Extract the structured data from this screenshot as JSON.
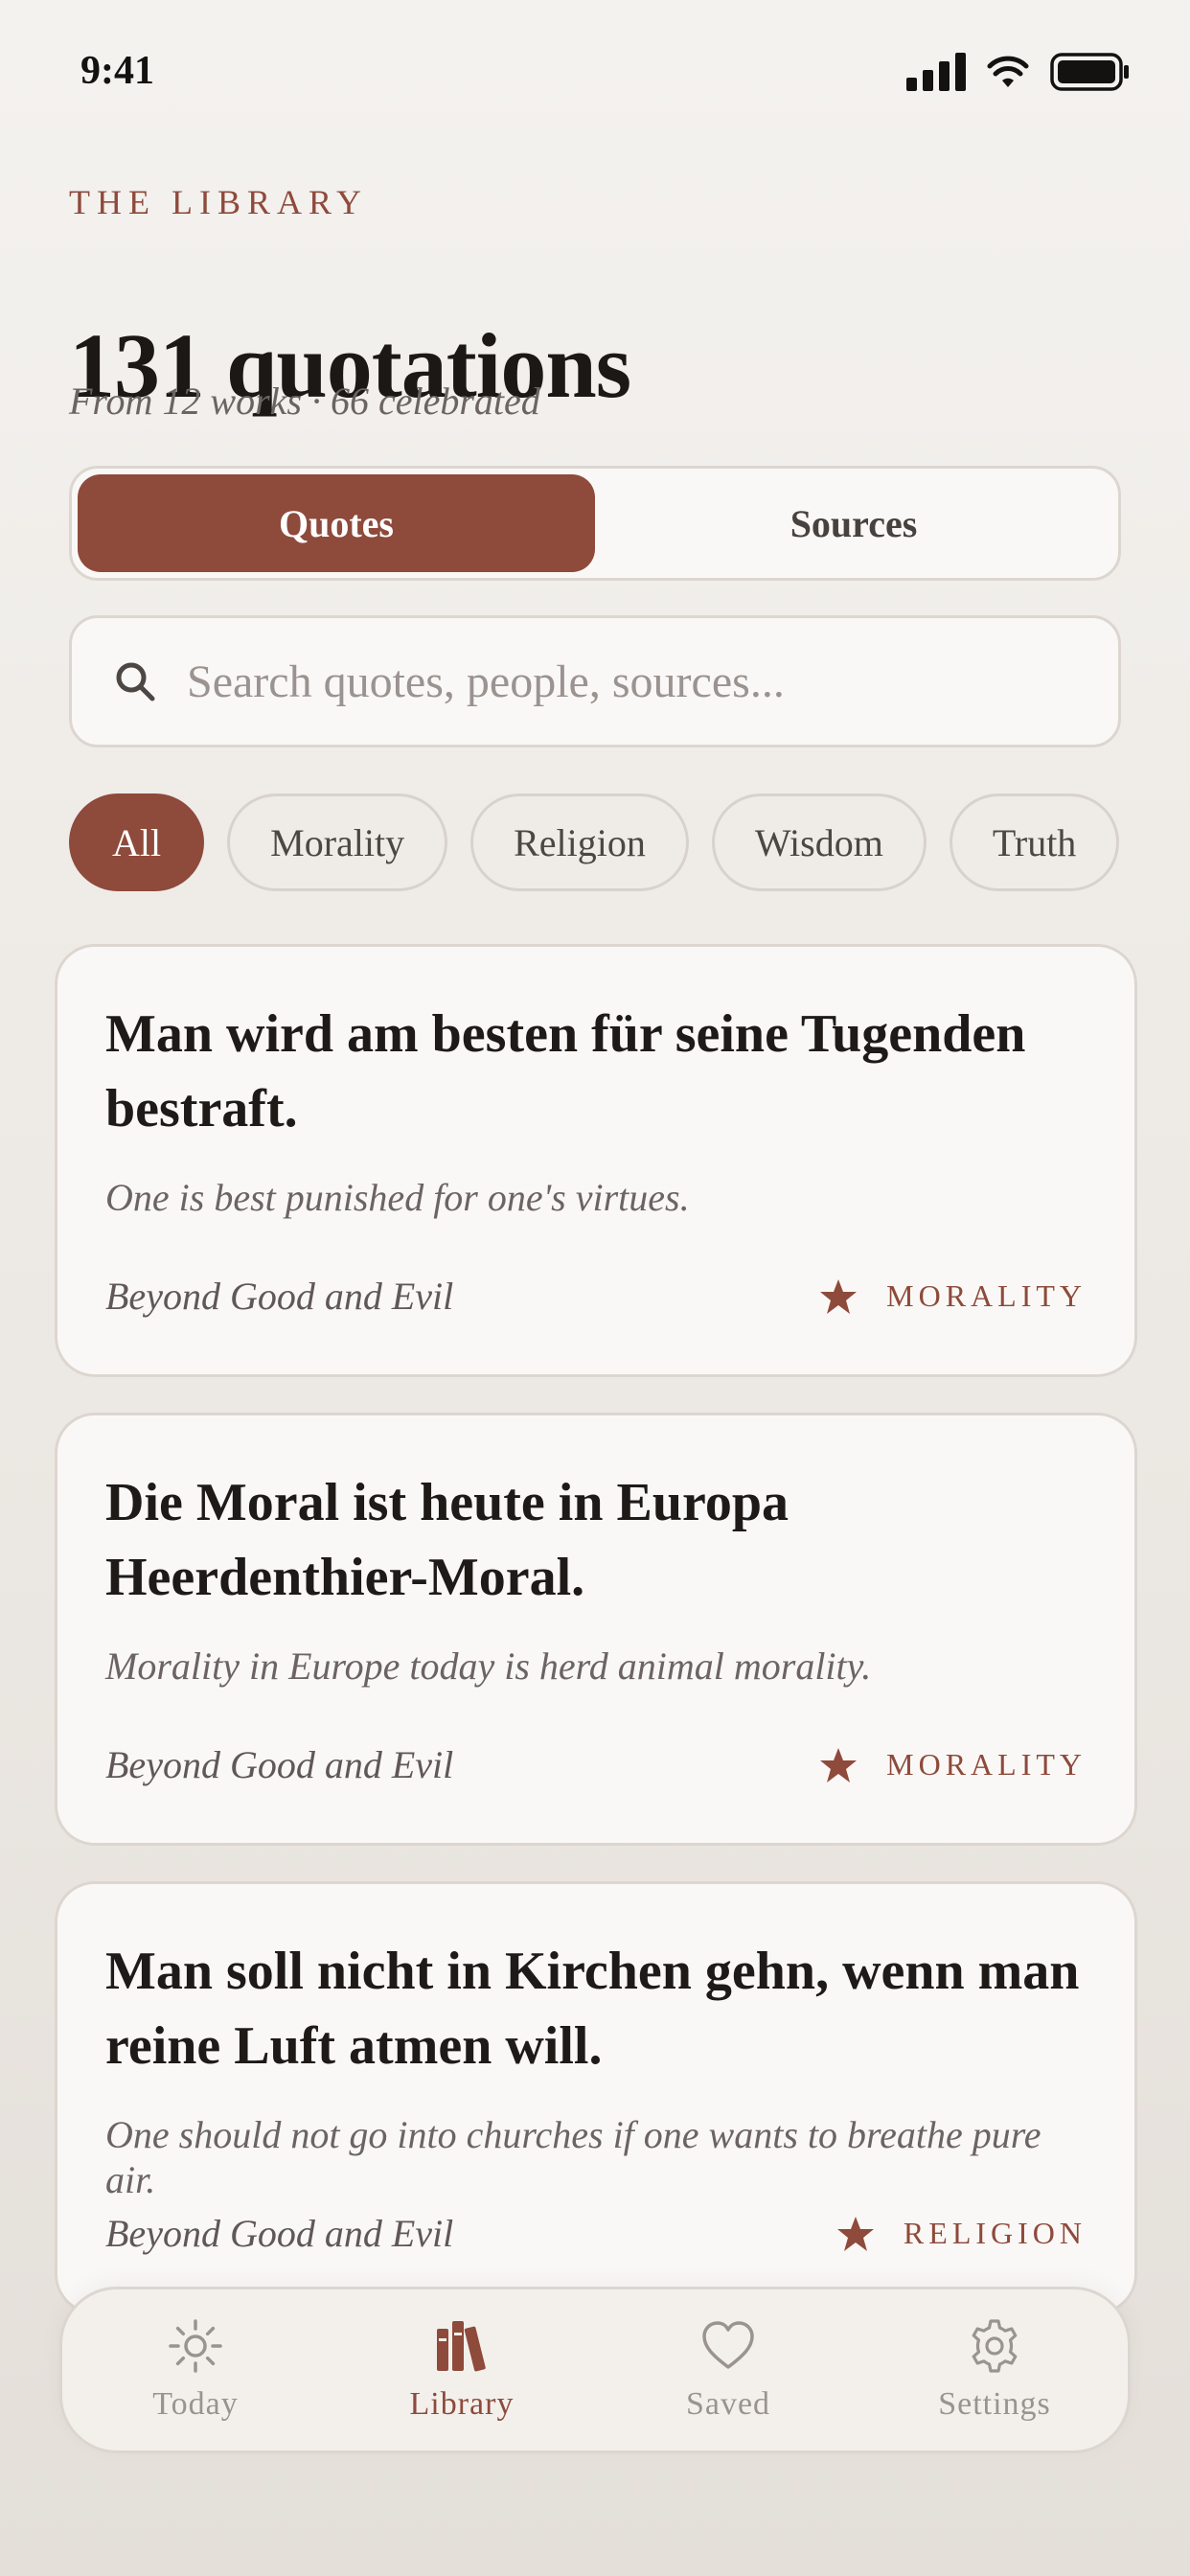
{
  "status_bar": {
    "time": "9:41"
  },
  "header": {
    "eyebrow": "THE LIBRARY",
    "title": "131 quotations",
    "subtitle": "From 12 works · 66 celebrated"
  },
  "segmented": {
    "items": [
      {
        "label": "Quotes",
        "active": true
      },
      {
        "label": "Sources",
        "active": false
      }
    ]
  },
  "search": {
    "placeholder": "Search quotes, people, sources...",
    "value": ""
  },
  "filters": {
    "chips": [
      {
        "label": "All",
        "active": true
      },
      {
        "label": "Morality",
        "active": false
      },
      {
        "label": "Religion",
        "active": false
      },
      {
        "label": "Wisdom",
        "active": false
      },
      {
        "label": "Truth",
        "active": false
      }
    ]
  },
  "quotes": [
    {
      "german": "Man wird am besten für seine Tugenden bestraft.",
      "english": "One is best punished for one's virtues.",
      "source": "Beyond Good and Evil",
      "tag": "MORALITY",
      "celebrated": true
    },
    {
      "german": "Die Moral ist heute in Europa Heerdenthier-Moral.",
      "english": "Morality in Europe today is herd animal morality.",
      "source": "Beyond Good and Evil",
      "tag": "MORALITY",
      "celebrated": true
    },
    {
      "german": "Man soll nicht in Kirchen gehn, wenn man reine Luft atmen will.",
      "english": "One should not go into churches if one wants to breathe pure air.",
      "source": "Beyond Good and Evil",
      "tag": "RELIGION",
      "celebrated": true
    }
  ],
  "tab_bar": {
    "items": [
      {
        "label": "Today",
        "icon": "sun-icon",
        "active": false
      },
      {
        "label": "Library",
        "icon": "books-icon",
        "active": true
      },
      {
        "label": "Saved",
        "icon": "heart-icon",
        "active": false
      },
      {
        "label": "Settings",
        "icon": "gear-icon",
        "active": false
      }
    ]
  },
  "colors": {
    "accent": "#8e4a3b",
    "background": "#f4f2ef",
    "card": "#faf8f6",
    "border": "#ddd6d0",
    "muted_text": "#6b6462"
  }
}
